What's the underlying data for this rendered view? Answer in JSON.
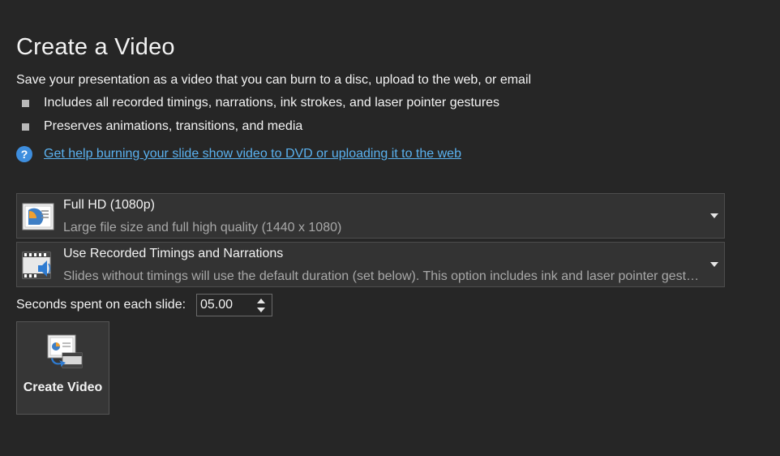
{
  "header": {
    "title": "Create a Video",
    "description": "Save your presentation as a video that you can burn to a disc, upload to the web, or email"
  },
  "bullets": [
    "Includes all recorded timings, narrations, ink strokes, and laser pointer gestures",
    "Preserves animations, transitions, and media"
  ],
  "help": {
    "icon": "help-icon",
    "glyph": "?",
    "link_text": "Get help burning your slide show video to DVD or uploading it to the web"
  },
  "quality_dropdown": {
    "icon": "video-quality-icon",
    "selected": "Full HD (1080p)",
    "description": "Large file size and full high quality (1440 x 1080)"
  },
  "timings_dropdown": {
    "icon": "timings-narration-icon",
    "selected": "Use Recorded Timings and Narrations",
    "description": "Slides without timings will use the default duration (set below). This option includes ink and laser pointer gestures."
  },
  "seconds": {
    "label": "Seconds spent on each slide:",
    "value": "05.00"
  },
  "create_button": {
    "icon": "create-video-icon",
    "label": "Create Video"
  },
  "colors": {
    "background": "#262626",
    "link": "#5ab1ef",
    "help_icon": "#3e8ede",
    "dropdown_bg": "#333333"
  }
}
